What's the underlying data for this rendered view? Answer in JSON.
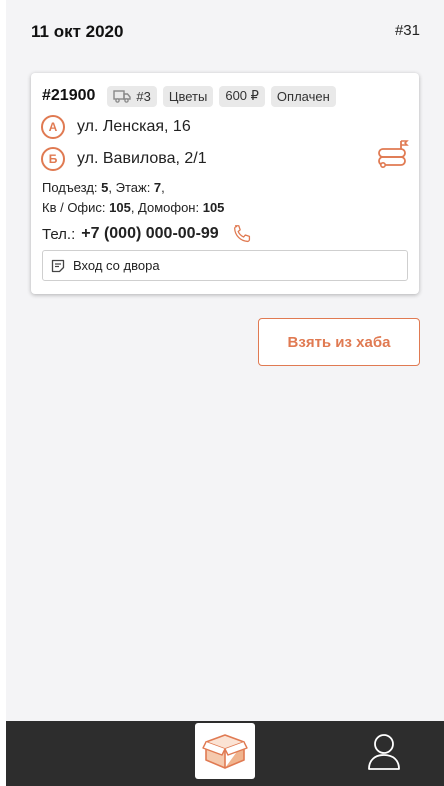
{
  "header": {
    "date": "11 окт 2020",
    "route_number": "#31"
  },
  "order": {
    "number": "#21900",
    "vehicle_chip": "#3",
    "category_chip": "Цветы",
    "price_chip": "600 ₽",
    "status_chip": "Оплачен",
    "point_a_label": "А",
    "point_a_address": "ул. Ленская, 16",
    "point_b_label": "Б",
    "point_b_address": "ул. Вавилова, 2/1",
    "entrance_label": "Подъезд: ",
    "entrance_value": "5",
    "floor_label": ", Этаж: ",
    "floor_value": "7",
    "floor_suffix": ",",
    "office_label": "Кв / Офис: ",
    "office_value": "105",
    "intercom_label": ", Домофон: ",
    "intercom_value": "105",
    "phone_label": "Тел.:",
    "phone_value": "+7 (000) 000-00-99",
    "note": "Вход со двора"
  },
  "actions": {
    "take_from_hub": "Взять из хаба"
  },
  "icons": {
    "vehicle": "truck-icon",
    "route": "route-icon",
    "phone": "phone-icon",
    "note": "note-icon",
    "orders_tab": "box-icon",
    "profile_tab": "user-icon"
  },
  "colors": {
    "accent": "#e07a52",
    "nav_background": "#2d2d2d",
    "screen_background": "#f4f4f6"
  }
}
